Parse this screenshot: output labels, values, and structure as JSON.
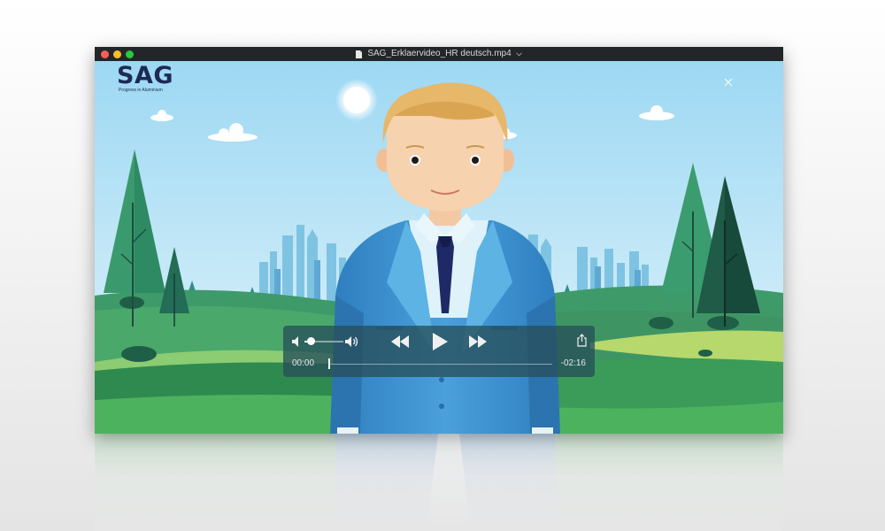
{
  "window": {
    "title": "SAG_Erklaervideo_HR deutsch.mp4"
  },
  "video": {
    "logo": {
      "name": "SAG",
      "tagline": "Progress in Aluminium"
    }
  },
  "controls": {
    "current_time": "00:00",
    "remaining_time": "-02:16",
    "volume_level": 0.15,
    "playback_progress": 0.0,
    "icons": [
      "volume-low-icon",
      "volume-high-icon",
      "rewind-icon",
      "play-icon",
      "fast-forward-icon",
      "share-icon"
    ]
  },
  "colors": {
    "sky": "#a8dcf2",
    "grass": "#4aa85a",
    "suit": "#3a8ccc",
    "tie": "#1e2a66",
    "control_bar": "#28505a"
  }
}
